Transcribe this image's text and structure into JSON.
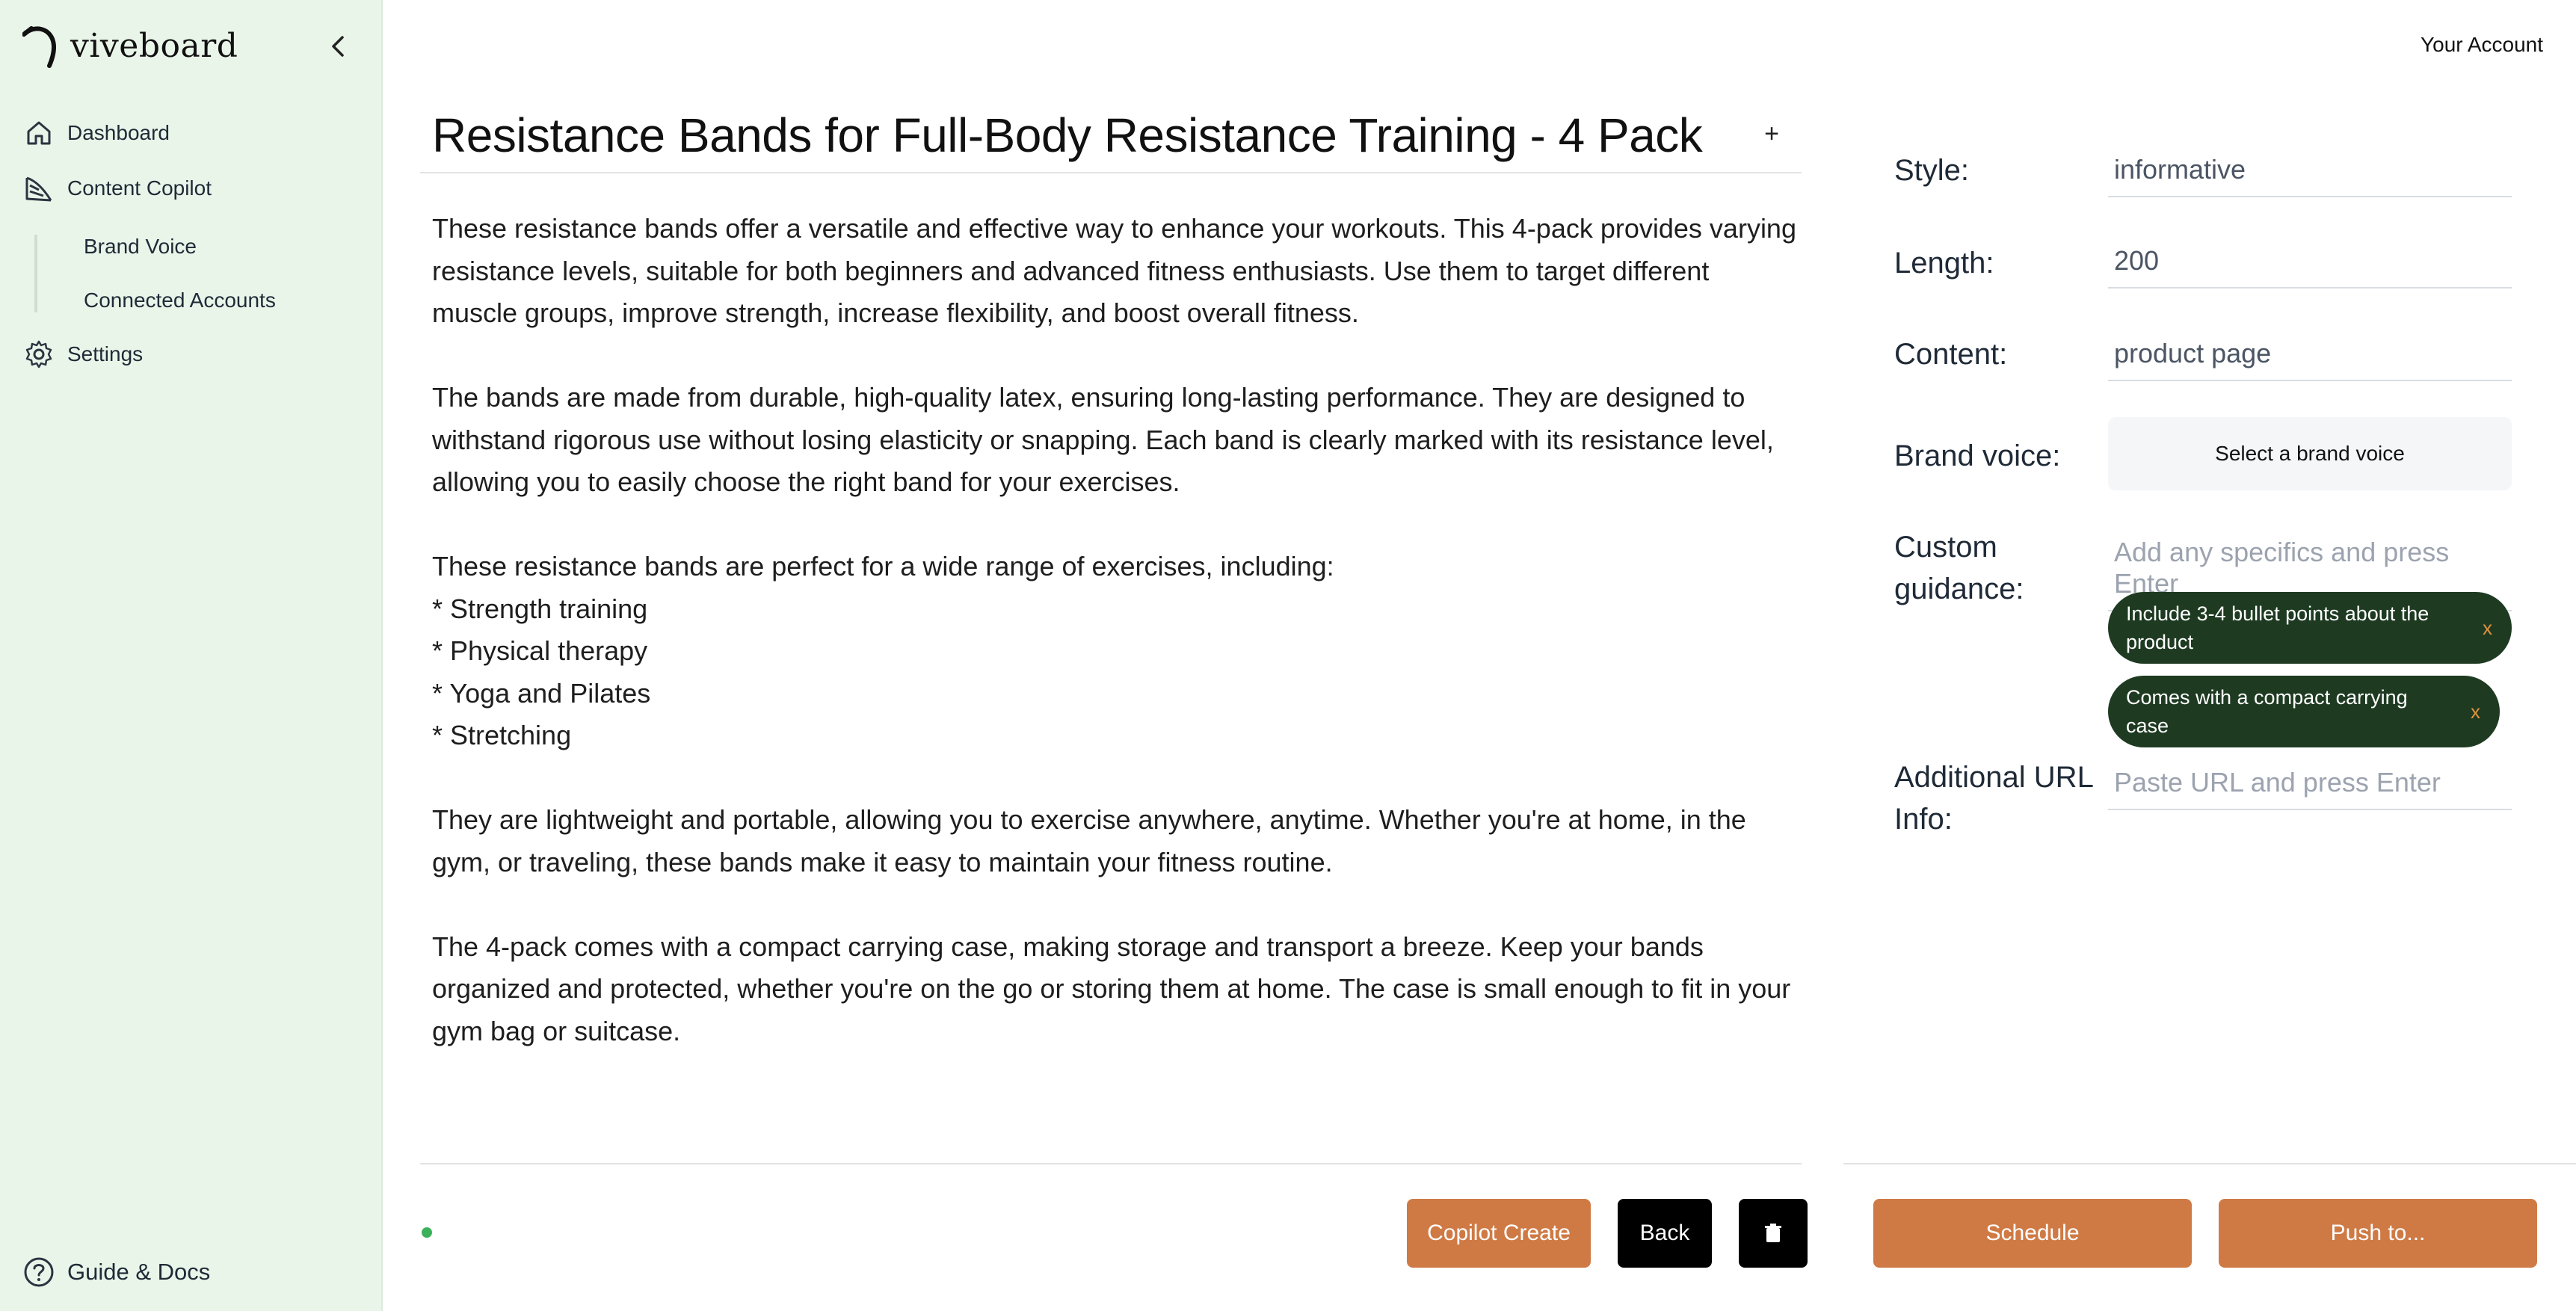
{
  "app": {
    "brand_name": "viveboard"
  },
  "sidebar": {
    "items": [
      {
        "label": "Dashboard",
        "icon": "home-icon"
      },
      {
        "label": "Content Copilot",
        "icon": "copilot-icon"
      }
    ],
    "sub_items": [
      {
        "label": "Brand Voice"
      },
      {
        "label": "Connected Accounts"
      }
    ],
    "settings": {
      "label": "Settings",
      "icon": "gear-icon"
    },
    "bottom": {
      "label": "Guide & Docs",
      "icon": "help-circle-icon"
    }
  },
  "header": {
    "account_label": "Your Account"
  },
  "editor": {
    "title": "Resistance Bands for Full-Body Resistance Training - 4 Pack",
    "add_symbol": "+",
    "paragraphs": [
      "These resistance bands offer a versatile and effective way to enhance your workouts. This 4-pack provides varying resistance levels, suitable for both beginners and advanced fitness enthusiasts. Use them to target different muscle groups, improve strength, increase flexibility, and boost overall fitness.",
      "The bands are made from durable, high-quality latex, ensuring long-lasting performance. They are designed to withstand rigorous use without losing elasticity or snapping. Each band is clearly marked with its resistance level, allowing you to easily choose the right band for your exercises.",
      "These resistance bands are perfect for a wide range of exercises, including:",
      "They are lightweight and portable, allowing you to exercise anywhere, anytime. Whether you're at home, in the gym, or traveling, these bands make it easy to maintain your fitness routine.",
      "The 4-pack comes with a compact carrying case, making storage and transport a breeze. Keep your bands organized and protected, whether you're on the go or storing them at home. The case is small enough to fit in your gym bag or suitcase."
    ],
    "bullets": [
      "* Strength training",
      "* Physical therapy",
      "* Yoga and Pilates",
      "* Stretching"
    ]
  },
  "actions": {
    "copilot_create": "Copilot Create",
    "back": "Back",
    "delete_icon": "trash-icon",
    "schedule": "Schedule",
    "push_to": "Push to..."
  },
  "settings_panel": {
    "style_label": "Style:",
    "style_value": "informative",
    "length_label": "Length:",
    "length_value": "200",
    "content_label": "Content:",
    "content_value": "product page",
    "brand_voice_label": "Brand voice:",
    "brand_voice_select": "Select a brand voice",
    "custom_guidance_label_1": "Custom",
    "custom_guidance_label_2": "guidance:",
    "custom_guidance_placeholder": "Add any specifics and press Enter",
    "guidance_chips": [
      {
        "text": "Include 3-4 bullet points about the product",
        "remove": "x"
      },
      {
        "text": "Comes with a compact carrying case",
        "remove": "x"
      }
    ],
    "url_label_1": "Additional URL",
    "url_label_2": "Info:",
    "url_placeholder": "Paste URL and press Enter"
  },
  "colors": {
    "sidebar_bg": "#eaf5ea",
    "accent_orange": "#cf7a45",
    "chip_bg": "#1e3b22",
    "chip_x": "#e2933f",
    "status_green": "#3cb15c"
  }
}
